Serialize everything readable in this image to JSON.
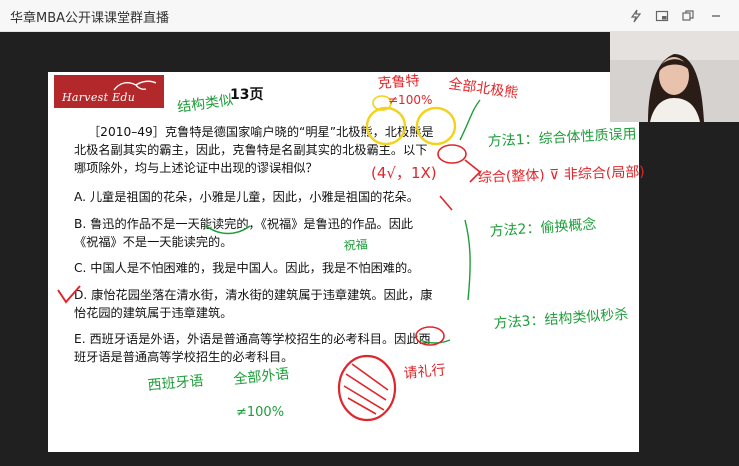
{
  "window": {
    "title": "华章MBA公开课课堂群直播"
  },
  "slide": {
    "logo_text": "Harvest Edu",
    "page_label": "13页",
    "question_lines": [
      "［2010–49］克鲁特是德国家喻户晓的“明星”北极熊，北极熊是",
      "北极名副其实的霸主，因此，克鲁特是名副其实的北极霸主。以下",
      "哪项除外，均与上述论证中出现的谬误相似？"
    ],
    "options": [
      "A. 儿童是祖国的花朵，小雅是儿童，因此，小雅是祖国的花朵。",
      "B. 鲁迅的作品不是一天能读完的，《祝福》是鲁迅的作品。因此",
      "《祝福》不是一天能读完的。",
      "C. 中国人是不怕困难的，我是中国人。因此，我是不怕困难的。",
      "D. 康怡花园坐落在清水街，清水街的建筑属于违章建筑。因此，康",
      "怡花园的建筑属于违章建筑。",
      "E. 西班牙语是外语，外语是普通高等学校招生的必考科目。因此西",
      "班牙语是普通高等学校招生的必考科目。"
    ]
  },
  "annotations": {
    "top_red": "克鲁特",
    "top_red_percent": "≠100%",
    "top_red_right": "全部北极熊",
    "structure": "结构类似",
    "method1": "方法1：综合体性质误用",
    "method1_sub": "(4√，1X)",
    "method1_sub2": "综合(整体) ⊽ 非综合(局部)",
    "method2": "方法2：偷换概念",
    "method3": "方法3：结构类似秒杀",
    "b_notes": "祝福",
    "e_notes1": "西班牙语",
    "e_notes2": "全部外语",
    "e_notes3": "≠100%",
    "choose": "请礼行"
  },
  "colors": {
    "red_ink": "#e0262a",
    "green_ink": "#1e9e3a",
    "yellow_ink": "#f2d21a",
    "brand": "#b3282a"
  }
}
